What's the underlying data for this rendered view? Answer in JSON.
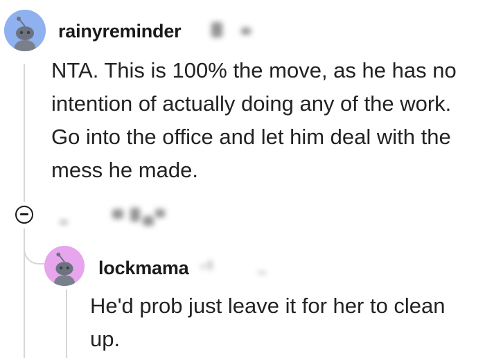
{
  "comments": [
    {
      "username": "rainyreminder",
      "avatar_color": "#8fb1ef",
      "body": "NTA. This is 100% the move, as he has no intention of actually doing any of the work. Go into the office and let him deal with the mess he made."
    },
    {
      "username": "lockmama",
      "avatar_color": "#e6a5ec",
      "body": "He'd prob just leave it for her to clean up."
    }
  ],
  "icons": {
    "collapse": "collapse-icon",
    "avatar": "snoo-avatar-icon"
  }
}
